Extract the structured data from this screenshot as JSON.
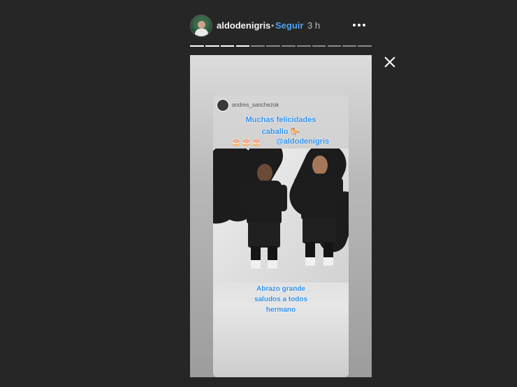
{
  "header": {
    "username": "aldodenigris",
    "separator": "•",
    "follow_label": "Seguir",
    "time_ago": "3 h"
  },
  "story": {
    "progress_segments": 12,
    "progress_completed": 4,
    "card": {
      "original_user": "andres_sanchezok",
      "line1": "Muchas felicidades",
      "line2": "caballo 🐎",
      "cakes": "🎂🎂🎂",
      "mention": "@aldodenigris",
      "bottom_line1": "Abrazo grande",
      "bottom_line2": "saludos a todos",
      "bottom_line3": "hermano"
    }
  },
  "colors": {
    "background": "#262626",
    "accent": "#4ea3f0",
    "story_text": "#2f8ee8"
  },
  "icons": {
    "more": "more-options-icon",
    "close": "close-icon"
  }
}
